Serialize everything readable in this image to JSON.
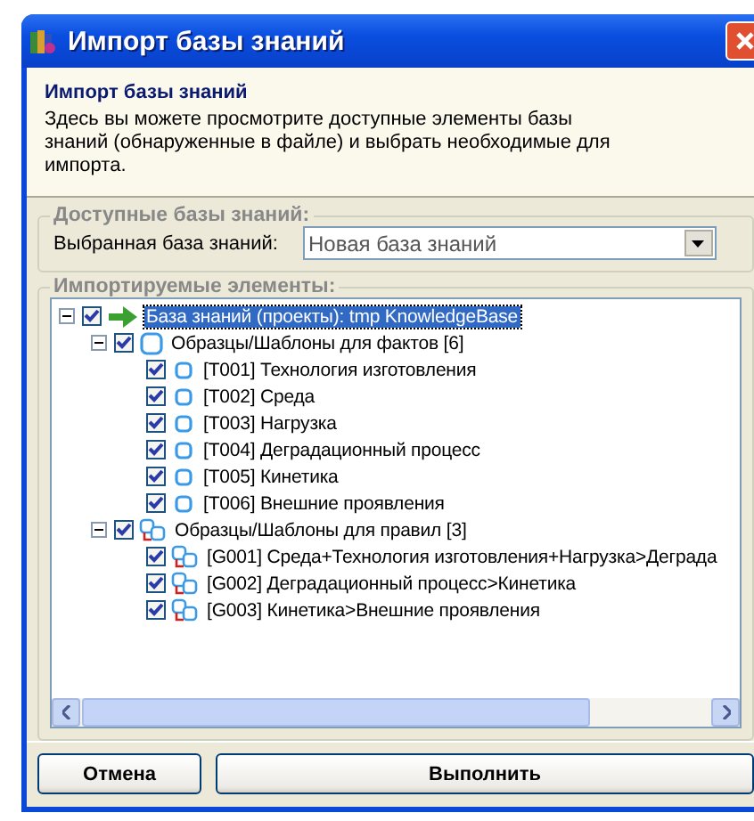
{
  "window": {
    "title": "Импорт базы знаний"
  },
  "header": {
    "title": "Импорт базы знаний",
    "description": "Здесь вы можете просмотрите доступные элементы базы знаний (обнаруженные в файле) и выбрать необходимые для импорта."
  },
  "available_group": {
    "title": "Доступные базы знаний:",
    "label": "Выбранная база знаний:",
    "value": "Новая база знаний"
  },
  "items_group": {
    "title": "Импортируемые элементы:",
    "tree": [
      {
        "kind": "root",
        "label": "База знаний (проекты): tmp KnowledgeBase",
        "checked": true,
        "selected": true,
        "expanded": true,
        "children": [
          {
            "kind": "facts",
            "label": "Образцы/Шаблоны для фактов [6]",
            "checked": true,
            "selected": false,
            "expanded": true,
            "children": [
              {
                "kind": "fact",
                "label": "[T001] Технология изготовления",
                "checked": true,
                "selected": false
              },
              {
                "kind": "fact",
                "label": "[T002] Среда",
                "checked": true,
                "selected": false
              },
              {
                "kind": "fact",
                "label": "[T003] Нагрузка",
                "checked": true,
                "selected": false
              },
              {
                "kind": "fact",
                "label": "[T004] Деградационный процесс",
                "checked": true,
                "selected": false
              },
              {
                "kind": "fact",
                "label": "[T005] Кинетика",
                "checked": true,
                "selected": false
              },
              {
                "kind": "fact",
                "label": "[T006] Внешние проявления",
                "checked": true,
                "selected": false
              }
            ]
          },
          {
            "kind": "rules",
            "label": "Образцы/Шаблоны для правил [3]",
            "checked": true,
            "selected": false,
            "expanded": true,
            "children": [
              {
                "kind": "rule",
                "label": "[G001] Среда+Технология изготовления+Нагрузка>Деграда",
                "checked": true,
                "selected": false
              },
              {
                "kind": "rule",
                "label": "[G002] Деградационный процесс>Кинетика",
                "checked": true,
                "selected": false
              },
              {
                "kind": "rule",
                "label": "[G003] Кинетика>Внешние проявления",
                "checked": true,
                "selected": false
              }
            ]
          }
        ]
      }
    ]
  },
  "buttons": [
    {
      "label": "Отмена",
      "kind": "small"
    },
    {
      "label": "Выполнить",
      "kind": "wide"
    }
  ]
}
